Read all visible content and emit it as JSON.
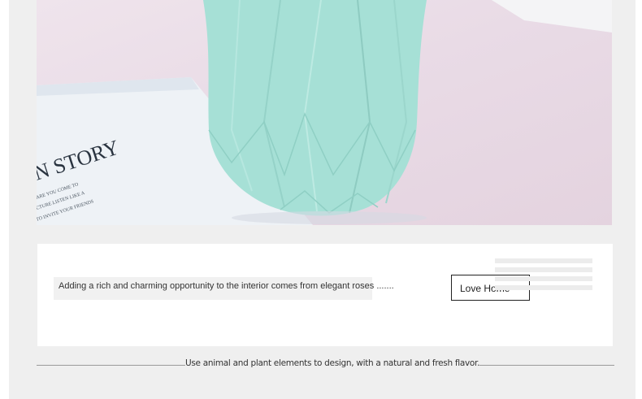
{
  "hero": {
    "image_label": "vase-product-photo",
    "book_text_line1": "N STORY",
    "book_text_line2": "ARE YOU COME TO",
    "book_text_line3": "CTURE LISTEN LIKE A",
    "book_text_line4": "TO INVITE YOUR FRIENDS"
  },
  "card": {
    "description": "Adding a rich and charming opportunity to the interior comes from elegant roses .......",
    "button_label": "Love Home"
  },
  "footer": {
    "tagline": "Use animal and plant elements to design, with a natural and fresh flavor."
  },
  "colors": {
    "vase": "#a6e0d6",
    "panel_bg": "#efefef",
    "card_bg": "#ffffff"
  }
}
